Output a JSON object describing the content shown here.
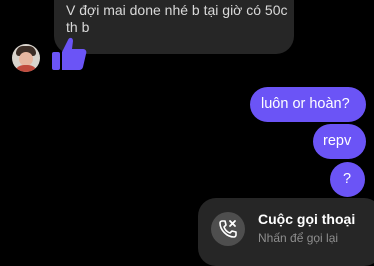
{
  "incoming": {
    "lines": [
      "V đợi mai done nhé b tại giờ có 50c",
      "th b"
    ],
    "reaction": "thumbs-up-icon"
  },
  "outgoing": [
    {
      "text": "luôn or hoàn?"
    },
    {
      "text": "repv"
    },
    {
      "text": "?"
    }
  ],
  "call": {
    "title": "Cuộc gọi thoại",
    "subtitle": "Nhấn để gọi lại",
    "icon": "missed-call-icon"
  },
  "colors": {
    "background": "#000000",
    "incoming_bubble": "#262626",
    "outgoing_bubble": "#6b54f6",
    "thumbs_up": "#6b54f6"
  }
}
